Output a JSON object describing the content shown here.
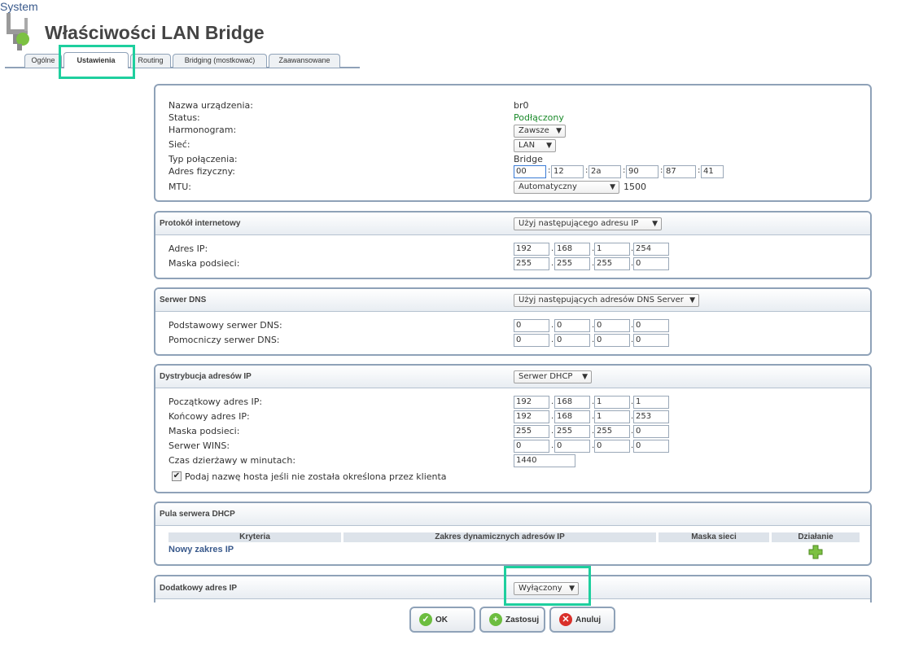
{
  "header": {
    "system_link": "System",
    "title": "Właściwości LAN Bridge"
  },
  "tabs": [
    {
      "label": "Ogólne"
    },
    {
      "label": "Ustawienia"
    },
    {
      "label": "Routing"
    },
    {
      "label": "Bridging (mostkować)"
    },
    {
      "label": "Zaawansowane"
    }
  ],
  "general": {
    "device_name_label": "Nazwa urządzenia:",
    "device_name": "br0",
    "status_label": "Status:",
    "status": "Podłączony",
    "schedule_label": "Harmonogram:",
    "schedule": "Zawsze",
    "network_label": "Sieć:",
    "network": "LAN",
    "conn_type_label": "Typ połączenia:",
    "conn_type": "Bridge",
    "mac_label": "Adres fizyczny:",
    "mac": [
      "00",
      "12",
      "2a",
      "90",
      "87",
      "41"
    ],
    "mtu_label": "MTU:",
    "mtu_mode": "Automatyczny",
    "mtu_value": "1500"
  },
  "ip_protocol": {
    "title": "Protokół internetowy",
    "mode": "Użyj następującego adresu IP",
    "ip_label": "Adres IP:",
    "ip": [
      "192",
      "168",
      "1",
      "254"
    ],
    "mask_label": "Maska podsieci:",
    "mask": [
      "255",
      "255",
      "255",
      "0"
    ]
  },
  "dns": {
    "title": "Serwer DNS",
    "mode": "Użyj następujących adresów DNS Server",
    "primary_label": "Podstawowy serwer DNS:",
    "primary": [
      "0",
      "0",
      "0",
      "0"
    ],
    "secondary_label": "Pomocniczy serwer DNS:",
    "secondary": [
      "0",
      "0",
      "0",
      "0"
    ]
  },
  "dhcp": {
    "title": "Dystrybucja adresów IP",
    "mode": "Serwer DHCP",
    "start_label": "Początkowy adres IP:",
    "start": [
      "192",
      "168",
      "1",
      "1"
    ],
    "end_label": "Końcowy adres IP:",
    "end": [
      "192",
      "168",
      "1",
      "253"
    ],
    "mask_label": "Maska podsieci:",
    "mask": [
      "255",
      "255",
      "255",
      "0"
    ],
    "wins_label": "Serwer WINS:",
    "wins": [
      "0",
      "0",
      "0",
      "0"
    ],
    "lease_label": "Czas dzierżawy w minutach:",
    "lease": "1440",
    "hostname_checkbox_label": "Podaj nazwę hosta jeśli nie została określona przez klienta",
    "hostname_checked": true
  },
  "pool": {
    "title": "Pula serwera DHCP",
    "columns": [
      "Kryteria",
      "Zakres dynamicznych adresów IP",
      "Maska sieci",
      "Działanie"
    ],
    "new_range": "Nowy zakres IP"
  },
  "extra_ip": {
    "title": "Dodatkowy adres IP",
    "mode": "Wyłączony"
  },
  "buttons": {
    "ok": "OK",
    "apply": "Zastosuj",
    "cancel": "Anuluj"
  },
  "icons": {
    "ok": "check-icon",
    "apply": "plus-icon",
    "cancel": "x-icon",
    "add": "plus-icon",
    "logo": "router-settings-icon"
  },
  "colors": {
    "highlight": "#1ecf9e",
    "status_ok": "#1a8a2a",
    "link": "#3a5a8c"
  }
}
